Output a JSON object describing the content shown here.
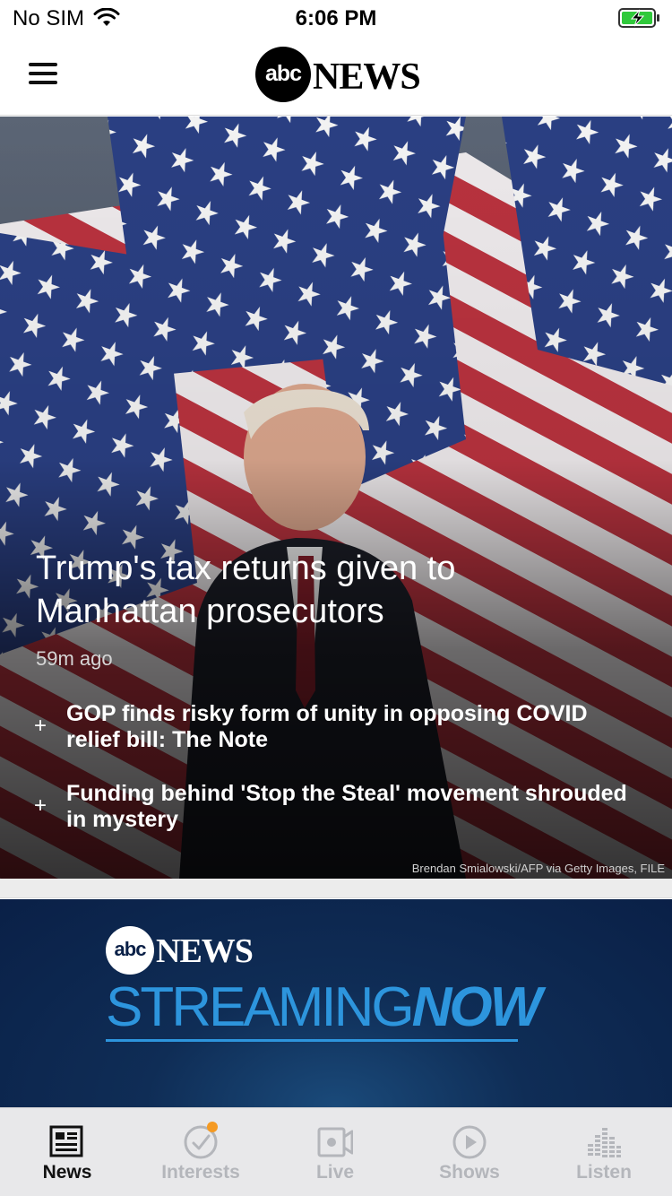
{
  "status_bar": {
    "carrier": "No SIM",
    "time": "6:06 PM",
    "battery_color": "#30c93b"
  },
  "header": {
    "logo_mark": "abc",
    "logo_word": "NEWS",
    "menu_icon": "hamburger-menu-icon"
  },
  "hero": {
    "headline": "Trump's tax returns given to Manhattan prosecutors",
    "timestamp": "59m ago",
    "related": [
      {
        "title": "GOP finds risky form of unity in opposing COVID relief bill: The Note",
        "icon": "plus-icon"
      },
      {
        "title": "Funding behind 'Stop the Steal' movement shrouded in mystery",
        "icon": "plus-icon"
      }
    ],
    "photo_credit": "Brendan Smialowski/AFP via Getty Images, FILE"
  },
  "stream_banner": {
    "logo_mark": "abc",
    "logo_word": "NEWS",
    "title_part1": "STREAMING",
    "title_part2": "NOW",
    "accent": "#2d95dd"
  },
  "tab_bar": {
    "tabs": [
      {
        "label": "News",
        "icon": "newspaper-icon",
        "active": true
      },
      {
        "label": "Interests",
        "icon": "check-circle-icon",
        "active": false,
        "badge": true
      },
      {
        "label": "Live",
        "icon": "video-camera-icon",
        "active": false
      },
      {
        "label": "Shows",
        "icon": "play-circle-icon",
        "active": false
      },
      {
        "label": "Listen",
        "icon": "equalizer-icon",
        "active": false
      }
    ],
    "badge_color": "#f59a23"
  }
}
